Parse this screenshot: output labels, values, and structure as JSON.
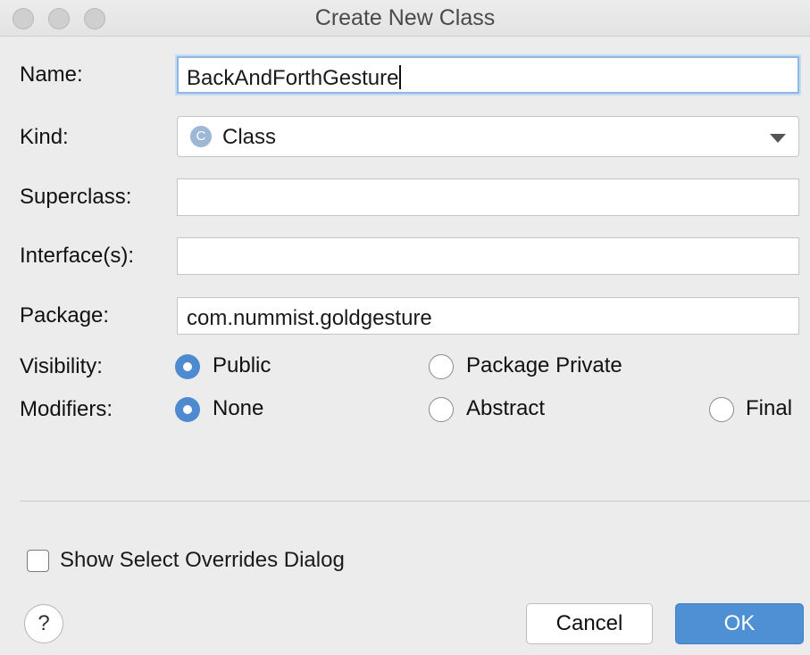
{
  "window": {
    "title": "Create New Class"
  },
  "form": {
    "name_label": "Name:",
    "name_value": "BackAndForthGesture",
    "kind_label": "Kind:",
    "kind_icon_letter": "C",
    "kind_value": "Class",
    "superclass_label": "Superclass:",
    "superclass_value": "",
    "interfaces_label": "Interface(s):",
    "interfaces_value": "",
    "package_label": "Package:",
    "package_value": "com.nummist.goldgesture"
  },
  "visibility": {
    "label": "Visibility:",
    "options": [
      {
        "label": "Public",
        "selected": true
      },
      {
        "label": "Package Private",
        "selected": false
      }
    ]
  },
  "modifiers": {
    "label": "Modifiers:",
    "options": [
      {
        "label": "None",
        "selected": true
      },
      {
        "label": "Abstract",
        "selected": false
      },
      {
        "label": "Final",
        "selected": false
      }
    ]
  },
  "overrides_checkbox": {
    "label": "Show Select Overrides Dialog",
    "checked": false
  },
  "buttons": {
    "help": "?",
    "cancel": "Cancel",
    "ok": "OK"
  },
  "colors": {
    "accent": "#4d8ad0",
    "ok_button": "#4f8fd3",
    "focus_ring": "#8fb7e3",
    "kind_icon": "#9eb7d5"
  }
}
